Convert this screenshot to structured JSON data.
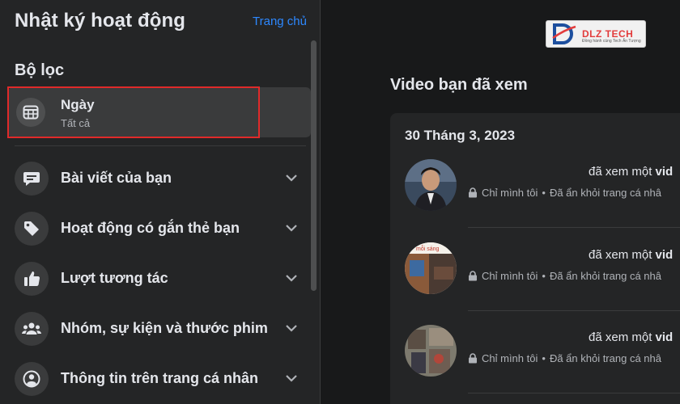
{
  "sidebar": {
    "title": "Nhật ký hoạt động",
    "home_link": "Trang chủ",
    "filter_heading": "Bộ lọc",
    "date_filter": {
      "label": "Ngày",
      "value": "Tất cả"
    },
    "items": [
      {
        "label": "Bài viết của bạn",
        "icon": "speech-bubble-icon"
      },
      {
        "label": "Hoạt động có gắn thẻ bạn",
        "icon": "tag-icon"
      },
      {
        "label": "Lượt tương tác",
        "icon": "thumbs-up-icon"
      },
      {
        "label": "Nhóm, sự kiện và thước phim",
        "icon": "group-icon"
      },
      {
        "label": "Thông tin trên trang cá nhân",
        "icon": "profile-icon"
      }
    ]
  },
  "logo": {
    "text": "DLZ TECH",
    "tagline": "Đồng hành cùng Tech Ấn Tượng"
  },
  "main": {
    "section_title": "Video bạn đã xem",
    "card": {
      "date": "30 Tháng 3, 2023",
      "entries": [
        {
          "action": "đã xem một ",
          "object": "vid",
          "privacy": "Chỉ mình tôi",
          "status": "Đã ẩn khỏi trang cá nhâ"
        },
        {
          "action": "đã xem một ",
          "object": "vid",
          "privacy": "Chỉ mình tôi",
          "status": "Đã ẩn khỏi trang cá nhâ",
          "thumb_caption": "mỗi sáng"
        },
        {
          "action": "đã xem một ",
          "object": "vid",
          "privacy": "Chỉ mình tôi",
          "status": "Đã ẩn khỏi trang cá nhâ"
        }
      ]
    }
  },
  "colors": {
    "background": "#18191a",
    "panel": "#242526",
    "accent": "#2d88ff",
    "highlight_box": "#e02a2a"
  }
}
